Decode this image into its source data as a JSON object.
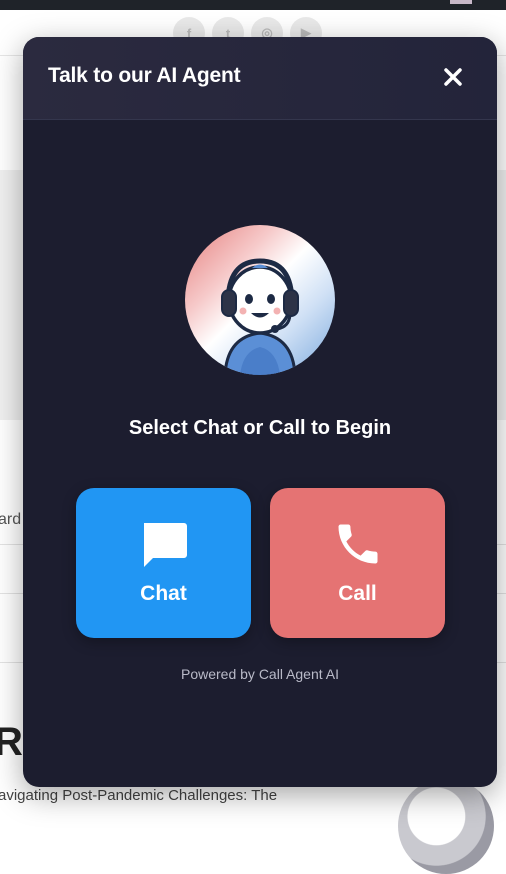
{
  "background": {
    "social_icons": [
      {
        "name": "facebook-icon",
        "glyph": "f"
      },
      {
        "name": "twitter-icon",
        "glyph": "t"
      },
      {
        "name": "instagram-icon",
        "glyph": "◎"
      },
      {
        "name": "youtube-icon",
        "glyph": "▶"
      }
    ],
    "partial_text_1": "ard",
    "heading_fragment": "Re",
    "subtitle_fragment": "avigating Post-Pandemic Challenges: The"
  },
  "modal": {
    "title": "Talk to our AI Agent",
    "close_icon": "close-icon",
    "avatar_icon": "support-agent-icon",
    "prompt": "Select Chat or Call to Begin",
    "chat": {
      "label": "Chat",
      "icon": "chat-bubble-icon",
      "color": "#2196f3"
    },
    "call": {
      "label": "Call",
      "icon": "phone-icon",
      "color": "#e57373"
    },
    "powered_by": "Powered by Call Agent AI"
  },
  "colors": {
    "modal_bg": "#1c1d2f",
    "header_bg": "#2b2a3f",
    "text": "#ffffff",
    "muted": "#b9bac8"
  }
}
